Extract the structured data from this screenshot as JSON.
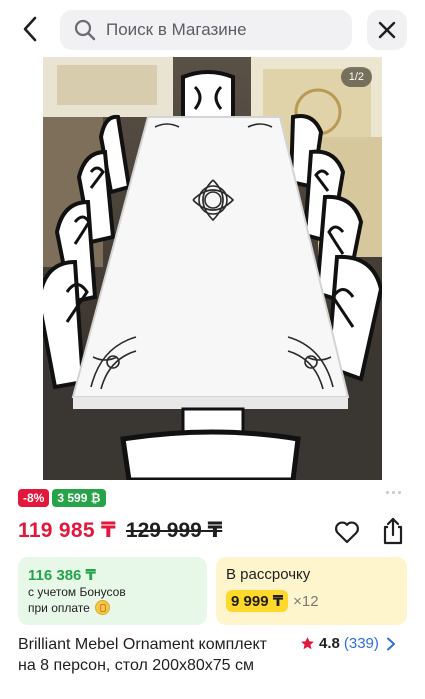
{
  "header": {
    "search_placeholder": "Поиск в Магазине",
    "back_icon": "chevron-left-icon",
    "search_icon": "search-icon",
    "close_icon": "close-icon"
  },
  "gallery": {
    "counter": "1/2",
    "current": 1,
    "total": 2
  },
  "badges": {
    "discount": "-8%",
    "bonus": "3 599 ₿"
  },
  "price": {
    "current": "119 985 ₸",
    "old": "129 999 ₸"
  },
  "bonus_card": {
    "amount": "116 386 ₸",
    "line1": "с учетом Бонусов",
    "line2": "при оплате"
  },
  "installment_card": {
    "title": "В рассрочку",
    "monthly": "9 999 ₸",
    "times": "×12"
  },
  "product": {
    "title": "Brilliant Mebel Ornament комплект на 8 персон, стол 200х80х75 см"
  },
  "rating": {
    "score": "4.8",
    "reviews": "(339)"
  },
  "colors": {
    "accent_red": "#e2173b",
    "bonus_green": "#27a34a",
    "installment_yellow": "#ffd82c",
    "link_blue": "#2f6fd6"
  }
}
